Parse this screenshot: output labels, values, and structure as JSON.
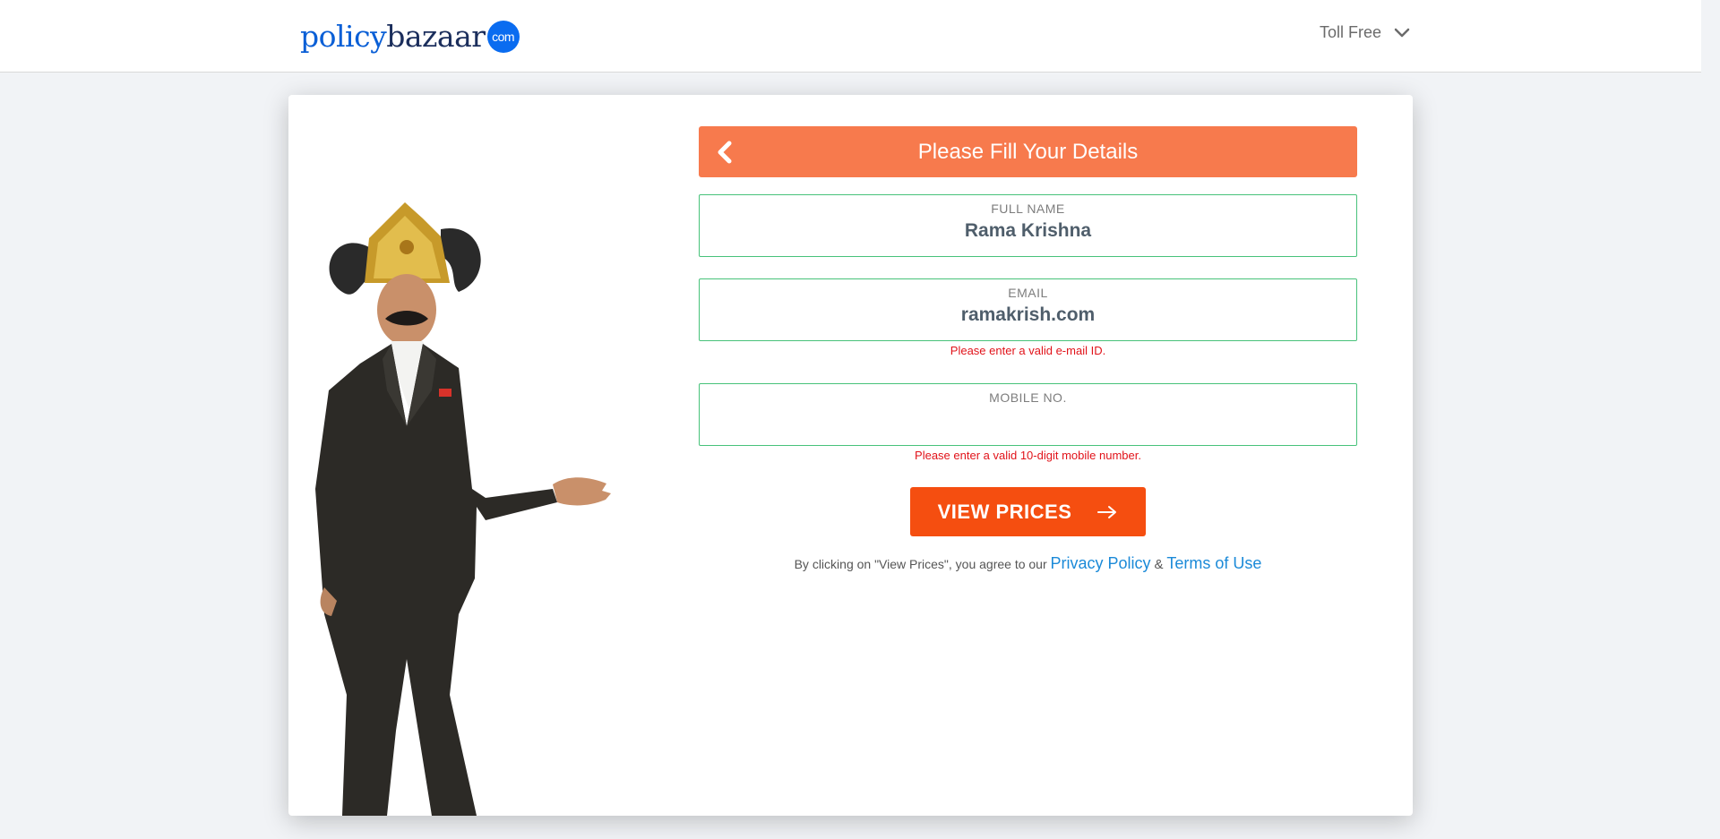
{
  "header": {
    "logo_policy": "policy",
    "logo_bazaar": "bazaar",
    "logo_com": "com",
    "toll_free_label": "Toll Free"
  },
  "form": {
    "title": "Please Fill Your Details",
    "full_name": {
      "label": "FULL NAME",
      "value": "Rama Krishna"
    },
    "email": {
      "label": "EMAIL",
      "value": "ramakrish.com",
      "error": "Please enter a valid e-mail ID."
    },
    "mobile": {
      "label": "MOBILE NO.",
      "value": "",
      "error": "Please enter a valid 10-digit mobile number."
    },
    "submit_label": "VIEW PRICES",
    "agree_prefix": "By clicking on \"View Prices\", you agree to our",
    "privacy_link": "Privacy Policy",
    "amp": "&",
    "terms_link": "Terms of Use"
  },
  "colors": {
    "header_accent": "#f77a4d",
    "button": "#f54e10",
    "field_border": "#47c27a",
    "error": "#e1131a",
    "link": "#1b8ad8"
  },
  "icons": {
    "back": "chevron-left-icon",
    "toll_free_toggle": "chevron-down-icon",
    "submit": "arrow-right-icon"
  }
}
